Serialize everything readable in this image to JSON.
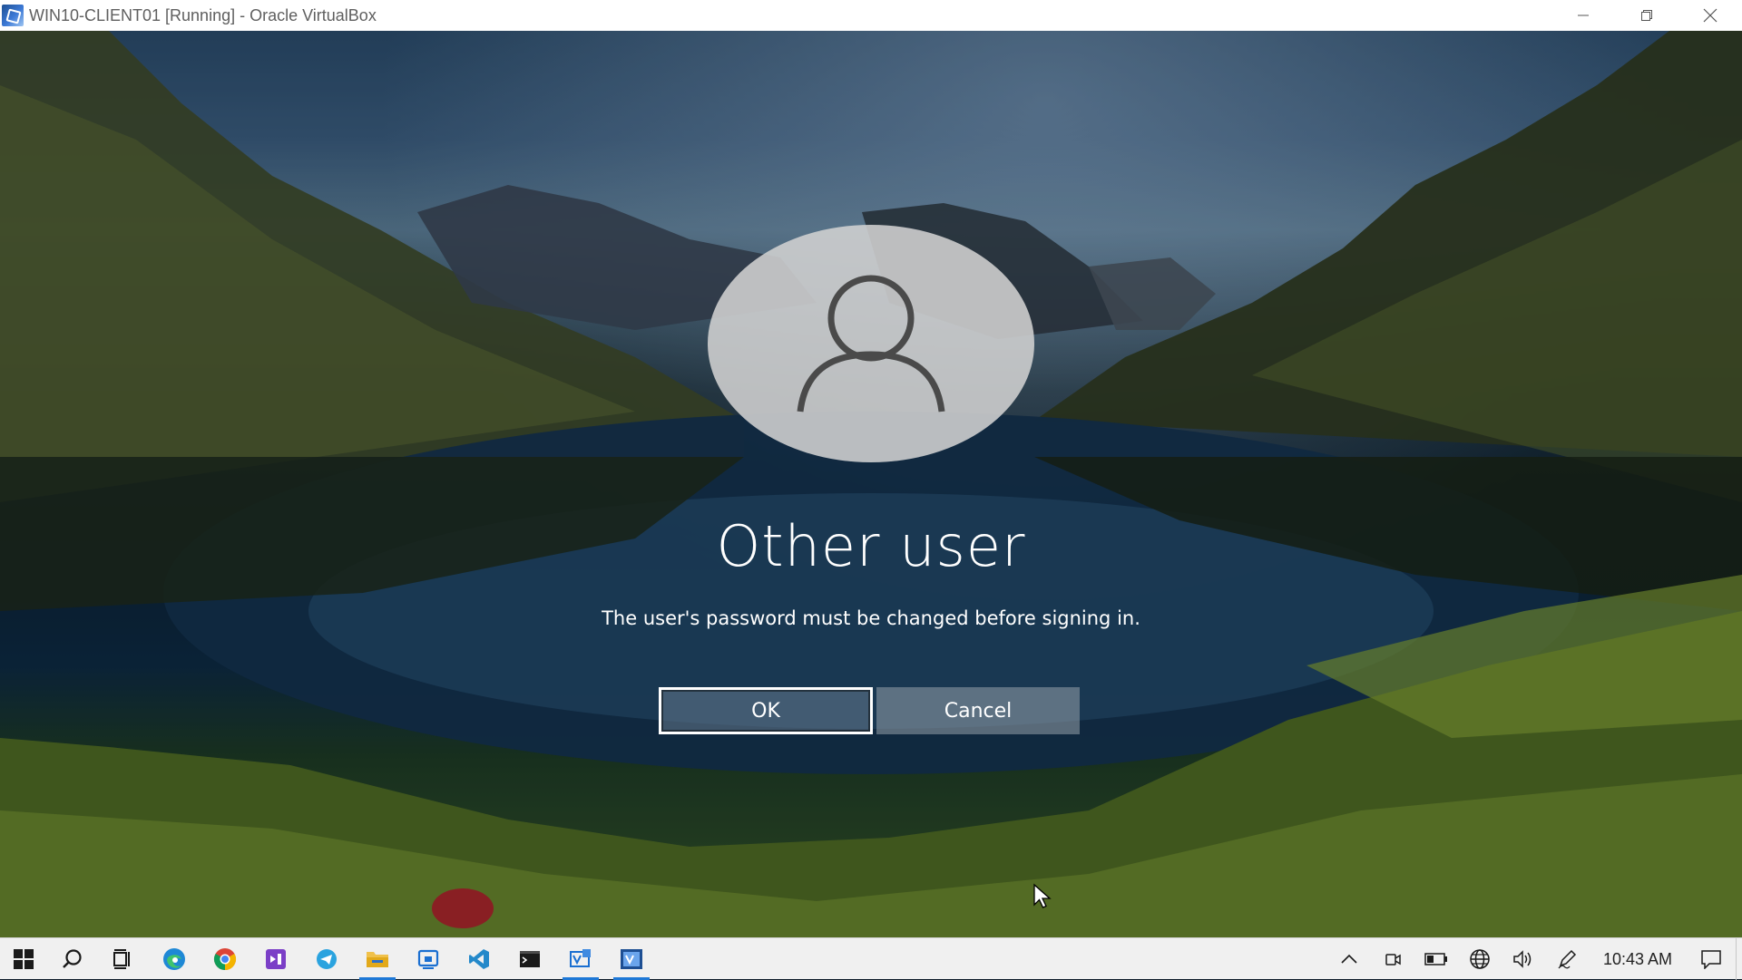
{
  "window": {
    "title": "WIN10-CLIENT01 [Running] - Oracle VirtualBox",
    "icon": "virtualbox-icon",
    "controls": [
      "minimize-icon",
      "restore-icon",
      "close-icon"
    ]
  },
  "signin": {
    "user_name": "Other user",
    "message": "The user's password must be changed before signing in.",
    "ok_label": "OK",
    "cancel_label": "Cancel",
    "avatar_icon": "user-avatar-icon"
  },
  "taskbar": {
    "apps": [
      {
        "name": "start-icon"
      },
      {
        "name": "search-icon"
      },
      {
        "name": "task-view-icon"
      },
      {
        "name": "edge-icon"
      },
      {
        "name": "chrome-icon"
      },
      {
        "name": "visual-studio-icon"
      },
      {
        "name": "telegram-icon"
      },
      {
        "name": "file-explorer-icon",
        "active": true
      },
      {
        "name": "remote-app-icon"
      },
      {
        "name": "vscode-icon"
      },
      {
        "name": "terminal-icon"
      },
      {
        "name": "virtualbox-manager-icon",
        "active": true
      },
      {
        "name": "virtualbox-vm-icon",
        "active": true
      }
    ],
    "tray": [
      "chevron-up-icon",
      "meet-now-icon",
      "battery-icon",
      "network-globe-icon",
      "volume-icon",
      "pen-icon"
    ],
    "clock": "10:43 AM",
    "notification_icon": "notification-icon"
  },
  "colors": {
    "accent": "#1e78d6",
    "taskbar_bg": "#f0f0f0"
  }
}
